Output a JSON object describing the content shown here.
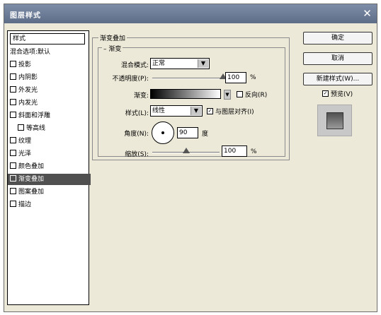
{
  "window": {
    "title": "图层样式",
    "close_icon": "close-icon"
  },
  "style_list": {
    "header": "样式",
    "items": [
      {
        "label": "混合选项:默认",
        "checkbox": false,
        "selected": false
      },
      {
        "label": "投影",
        "checkbox": true,
        "selected": false
      },
      {
        "label": "内阴影",
        "checkbox": true,
        "selected": false
      },
      {
        "label": "外发光",
        "checkbox": true,
        "selected": false
      },
      {
        "label": "内发光",
        "checkbox": true,
        "selected": false
      },
      {
        "label": "斜面和浮雕",
        "checkbox": true,
        "selected": false
      },
      {
        "label": "等高线",
        "checkbox": true,
        "selected": false
      },
      {
        "label": "纹理",
        "checkbox": true,
        "selected": false
      },
      {
        "label": "光泽",
        "checkbox": true,
        "selected": false
      },
      {
        "label": "颜色叠加",
        "checkbox": true,
        "selected": false
      },
      {
        "label": "渐变叠加",
        "checkbox": true,
        "selected": true
      },
      {
        "label": "图案叠加",
        "checkbox": true,
        "selected": false
      },
      {
        "label": "描边",
        "checkbox": true,
        "selected": false
      }
    ]
  },
  "panel": {
    "group_title": "渐变叠加",
    "inner_title": "渐变",
    "blend_mode": {
      "label": "混合模式:",
      "value": "正常"
    },
    "opacity": {
      "label": "不透明度(P):",
      "value": "100",
      "unit": "%",
      "level": 1.0
    },
    "gradient": {
      "label": "渐变:",
      "reverse_label": "反向(R)",
      "reverse_checked": false
    },
    "style": {
      "label": "样式(L):",
      "value": "线性",
      "align_label": "与图层对齐(I)",
      "align_checked": true
    },
    "angle": {
      "label": "角度(N):",
      "value": "90",
      "unit": "度"
    },
    "scale": {
      "label": "缩放(S):",
      "value": "100",
      "unit": "%",
      "level": 0.5
    }
  },
  "buttons": {
    "ok": "确定",
    "cancel": "取消",
    "new_style": "新建样式(W)...",
    "preview_label": "预览(V)",
    "preview_checked": true
  }
}
